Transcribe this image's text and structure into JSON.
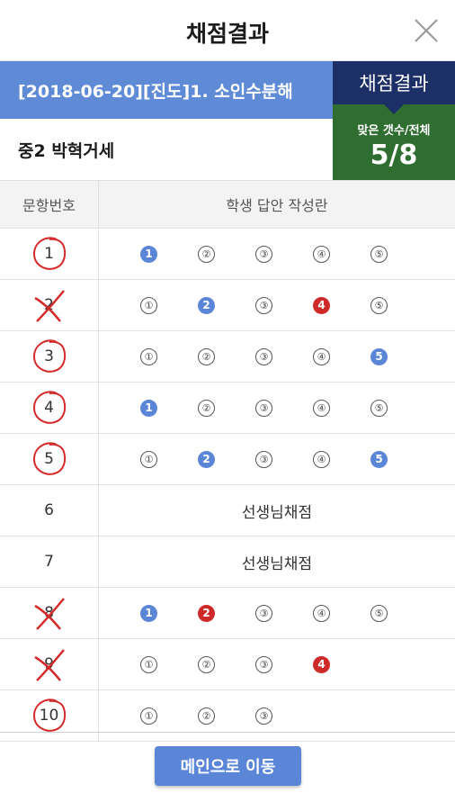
{
  "header": {
    "title": "채점결과",
    "close_icon": "close-icon"
  },
  "exam": {
    "title": "[2018-06-20][진도]1. 소인수분해",
    "student": "중2 박혁거세"
  },
  "result": {
    "label": "채점결과",
    "caption": "맞은 갯수/전체",
    "score": "5/8"
  },
  "table": {
    "col_number": "문항번호",
    "col_answers": "학생 답안 작성란",
    "rows": [
      {
        "num": "1",
        "mark": "circle",
        "choices": [
          {
            "t": "1",
            "s": "blue"
          },
          {
            "t": "②",
            "s": "plain"
          },
          {
            "t": "③",
            "s": "plain"
          },
          {
            "t": "④",
            "s": "plain"
          },
          {
            "t": "⑤",
            "s": "plain"
          }
        ]
      },
      {
        "num": "2",
        "mark": "cross",
        "choices": [
          {
            "t": "①",
            "s": "plain"
          },
          {
            "t": "2",
            "s": "blue"
          },
          {
            "t": "③",
            "s": "plain"
          },
          {
            "t": "4",
            "s": "red"
          },
          {
            "t": "⑤",
            "s": "plain"
          }
        ]
      },
      {
        "num": "3",
        "mark": "circle",
        "choices": [
          {
            "t": "①",
            "s": "plain"
          },
          {
            "t": "②",
            "s": "plain"
          },
          {
            "t": "③",
            "s": "plain"
          },
          {
            "t": "④",
            "s": "plain"
          },
          {
            "t": "5",
            "s": "blue"
          }
        ]
      },
      {
        "num": "4",
        "mark": "circle",
        "choices": [
          {
            "t": "1",
            "s": "blue"
          },
          {
            "t": "②",
            "s": "plain"
          },
          {
            "t": "③",
            "s": "plain"
          },
          {
            "t": "④",
            "s": "plain"
          },
          {
            "t": "⑤",
            "s": "plain"
          }
        ]
      },
      {
        "num": "5",
        "mark": "circle",
        "choices": [
          {
            "t": "①",
            "s": "plain"
          },
          {
            "t": "2",
            "s": "blue"
          },
          {
            "t": "③",
            "s": "plain"
          },
          {
            "t": "④",
            "s": "plain"
          },
          {
            "t": "5",
            "s": "blue"
          }
        ]
      },
      {
        "num": "6",
        "mark": "none",
        "teacher": "선생님채점"
      },
      {
        "num": "7",
        "mark": "none",
        "teacher": "선생님채점"
      },
      {
        "num": "8",
        "mark": "cross",
        "choices": [
          {
            "t": "1",
            "s": "blue"
          },
          {
            "t": "2",
            "s": "red"
          },
          {
            "t": "③",
            "s": "plain"
          },
          {
            "t": "④",
            "s": "plain"
          },
          {
            "t": "⑤",
            "s": "plain"
          }
        ]
      },
      {
        "num": "9",
        "mark": "cross",
        "choices": [
          {
            "t": "①",
            "s": "plain"
          },
          {
            "t": "②",
            "s": "plain"
          },
          {
            "t": "③",
            "s": "plain"
          },
          {
            "t": "4",
            "s": "red"
          }
        ]
      },
      {
        "num": "10",
        "mark": "circle",
        "choices": [
          {
            "t": "①",
            "s": "plain"
          },
          {
            "t": "②",
            "s": "plain"
          },
          {
            "t": "③",
            "s": "plain"
          }
        ]
      }
    ]
  },
  "footer": {
    "main_button": "메인으로 이동"
  },
  "colors": {
    "accent_blue": "#5b86d8",
    "navy": "#1c2f67",
    "green": "#2f6e30",
    "red_mark": "#d42a2a"
  }
}
